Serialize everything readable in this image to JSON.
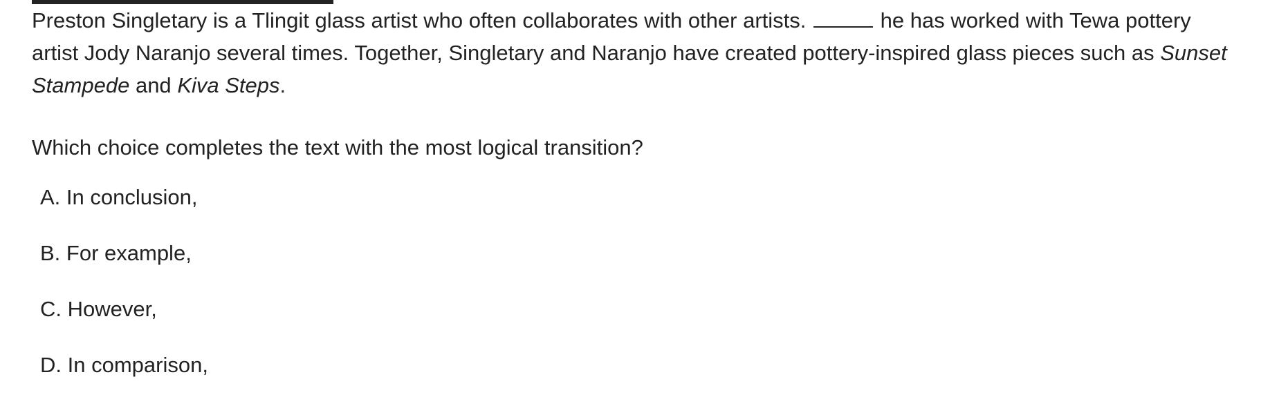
{
  "passage": {
    "part1": "Preston Singletary is a Tlingit glass artist who often collaborates with other artists.",
    "part2": "he has worked with Tewa pottery artist Jody Naranjo several times. Together, Singletary and Naranjo have created pottery-inspired glass pieces such as",
    "title1": "Sunset Stampede",
    "connector": "and",
    "title2": "Kiva Steps",
    "end": "."
  },
  "question": "Which choice completes the text with the most logical transition?",
  "choices": [
    {
      "text": "A. In conclusion,"
    },
    {
      "text": "B. For example,"
    },
    {
      "text": "C. However,"
    },
    {
      "text": "D. In comparison,"
    }
  ]
}
